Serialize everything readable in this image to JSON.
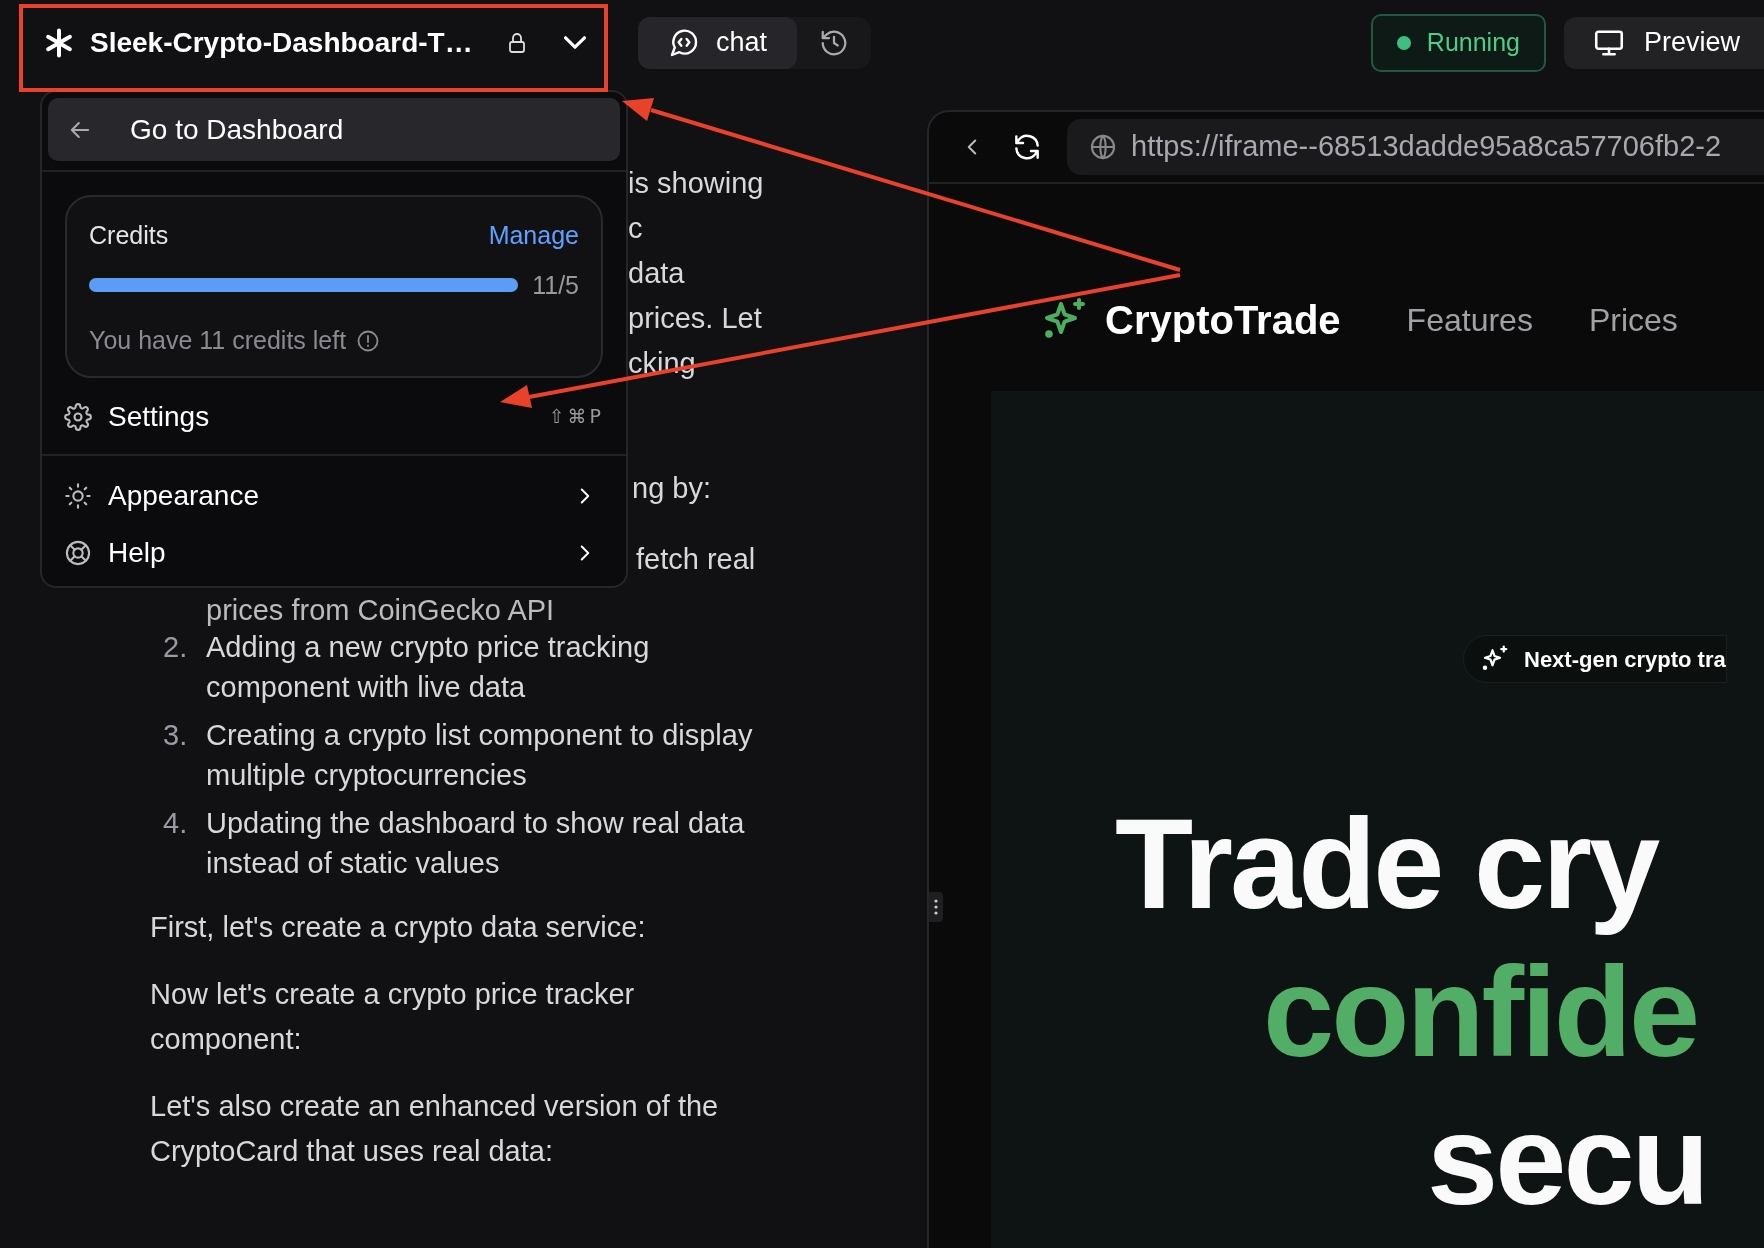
{
  "project": {
    "title": "Sleek-Crypto-Dashboard-T…"
  },
  "mode_tabs": [
    {
      "label": "chat",
      "selected": true
    }
  ],
  "status": {
    "label": "Running"
  },
  "preview_button": {
    "label": "Preview"
  },
  "project_menu": {
    "back_item": "Go to Dashboard",
    "credits": {
      "title": "Credits",
      "manage_link": "Manage",
      "level": 1,
      "reading": "11/5",
      "note": "You have 11 credits left"
    },
    "items": [
      {
        "kind": "shortcut",
        "label": "Settings",
        "shortcut": "⇧⌘P"
      },
      {
        "kind": "submenu",
        "label": "Appearance"
      },
      {
        "kind": "submenu",
        "label": "Help"
      }
    ]
  },
  "chat": {
    "fragments": [
      "is showing",
      "c",
      "data",
      "prices. Let",
      "cking"
    ],
    "fragment_2": "ng by:",
    "list_item_1": {
      "fragment": "fetch real",
      "continuation": "prices from CoinGecko API"
    },
    "list_items": [
      {
        "number": "2.",
        "text": "Adding a new crypto price tracking component with live data"
      },
      {
        "number": "3.",
        "text": "Creating a crypto list component to display multiple cryptocurrencies"
      },
      {
        "number": "4.",
        "text": "Updating the dashboard to show real data instead of static values"
      }
    ],
    "paragraphs": [
      "First, let's create a crypto data service:",
      "Now let's create a crypto price tracker component:",
      "Let's also create an enhanced version of the CryptoCard that uses real data:"
    ]
  },
  "preview": {
    "url": "https://iframe--68513dadde95a8ca57706fb2-2",
    "site": {
      "brand": "CryptoTrade",
      "nav": [
        "Features",
        "Prices"
      ],
      "badge": "Next-gen crypto tra",
      "hero_lines": [
        {
          "text": "Trade cry",
          "accent": false
        },
        {
          "text": "confide",
          "accent": true
        },
        {
          "text": "secu",
          "accent": false
        }
      ]
    }
  }
}
